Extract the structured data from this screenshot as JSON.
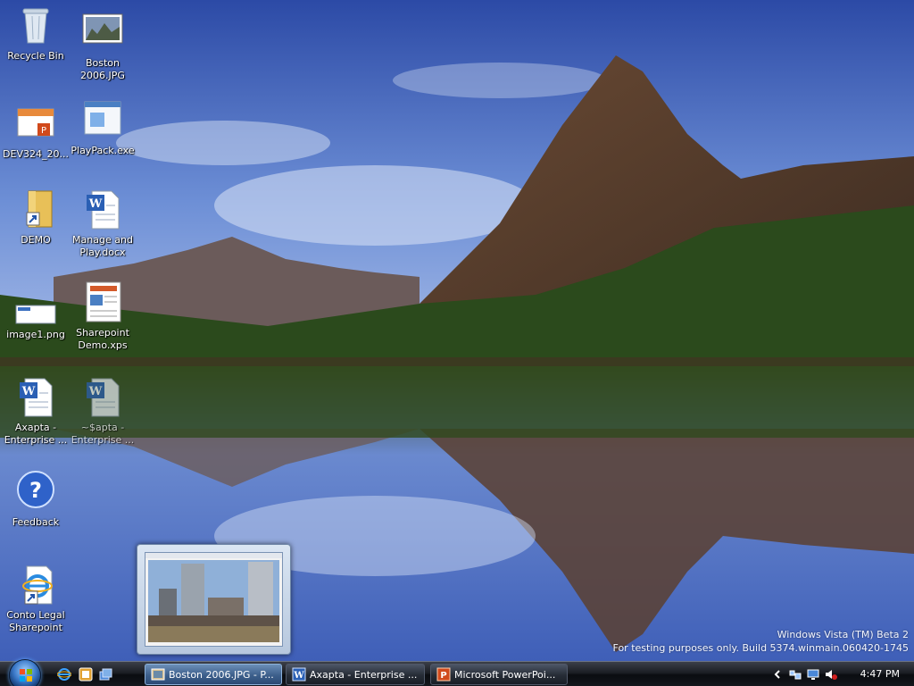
{
  "desktop": {
    "icons": [
      {
        "label": "Recycle Bin"
      },
      {
        "label": "Boston\n2006.JPG"
      },
      {
        "label": "DEV324_20..."
      },
      {
        "label": "PlayPack.exe"
      },
      {
        "label": "DEMO"
      },
      {
        "label": "Manage and\nPlay.docx"
      },
      {
        "label": "image1.png"
      },
      {
        "label": "Sharepoint\nDemo.xps"
      },
      {
        "label": "Axapta -\nEnterprise ..."
      },
      {
        "label": "~$apta -\nEnterprise ..."
      },
      {
        "label": "Feedback"
      },
      {
        "label": "Conto Legal\nSharepoint"
      }
    ]
  },
  "watermark": {
    "line1": "Windows Vista (TM) Beta 2",
    "line2": "For testing purposes only. Build 5374.winmain.060420-1745"
  },
  "taskbar": {
    "buttons": [
      {
        "label": "Boston 2006.JPG - P...",
        "icon": "photo-icon"
      },
      {
        "label": "Axapta - Enterprise ...",
        "icon": "word-icon"
      },
      {
        "label": "Microsoft PowerPoi...",
        "icon": "powerpoint-icon"
      }
    ],
    "quick_launch": [
      "ie-icon",
      "media-icon",
      "switch-windows-icon"
    ],
    "tray_icons": [
      "show-hidden-icon",
      "network-icon",
      "monitor-icon",
      "volume-muted-icon"
    ],
    "clock": "4:47 PM"
  },
  "colors": {
    "taskbar_dark": "#0a0c10",
    "active_button": "#3d5f8b",
    "sky_top": "#2f4ea8"
  }
}
